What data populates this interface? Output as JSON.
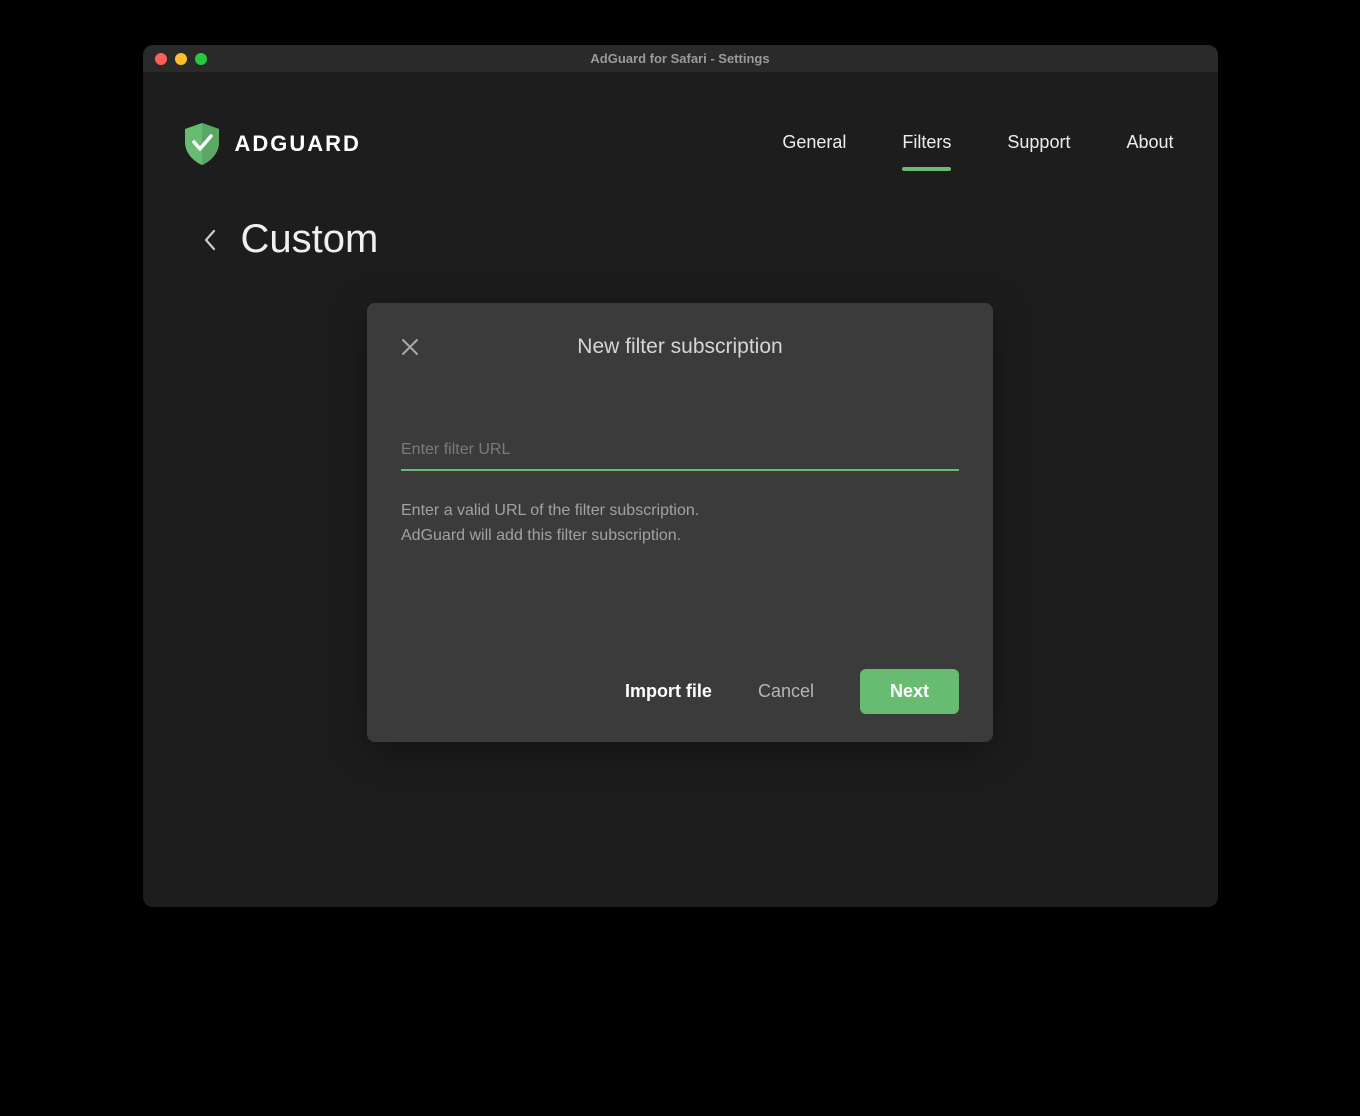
{
  "window": {
    "title": "AdGuard for Safari - Settings"
  },
  "logo": {
    "text": "ADGUARD"
  },
  "nav": {
    "items": [
      {
        "label": "General",
        "active": false
      },
      {
        "label": "Filters",
        "active": true
      },
      {
        "label": "Support",
        "active": false
      },
      {
        "label": "About",
        "active": false
      }
    ]
  },
  "page": {
    "title": "Custom"
  },
  "modal": {
    "title": "New filter subscription",
    "input_placeholder": "Enter filter URL",
    "input_value": "",
    "hint_line1": "Enter a valid URL of the filter subscription.",
    "hint_line2": "AdGuard will add this filter subscription.",
    "import_label": "Import file",
    "cancel_label": "Cancel",
    "next_label": "Next"
  }
}
